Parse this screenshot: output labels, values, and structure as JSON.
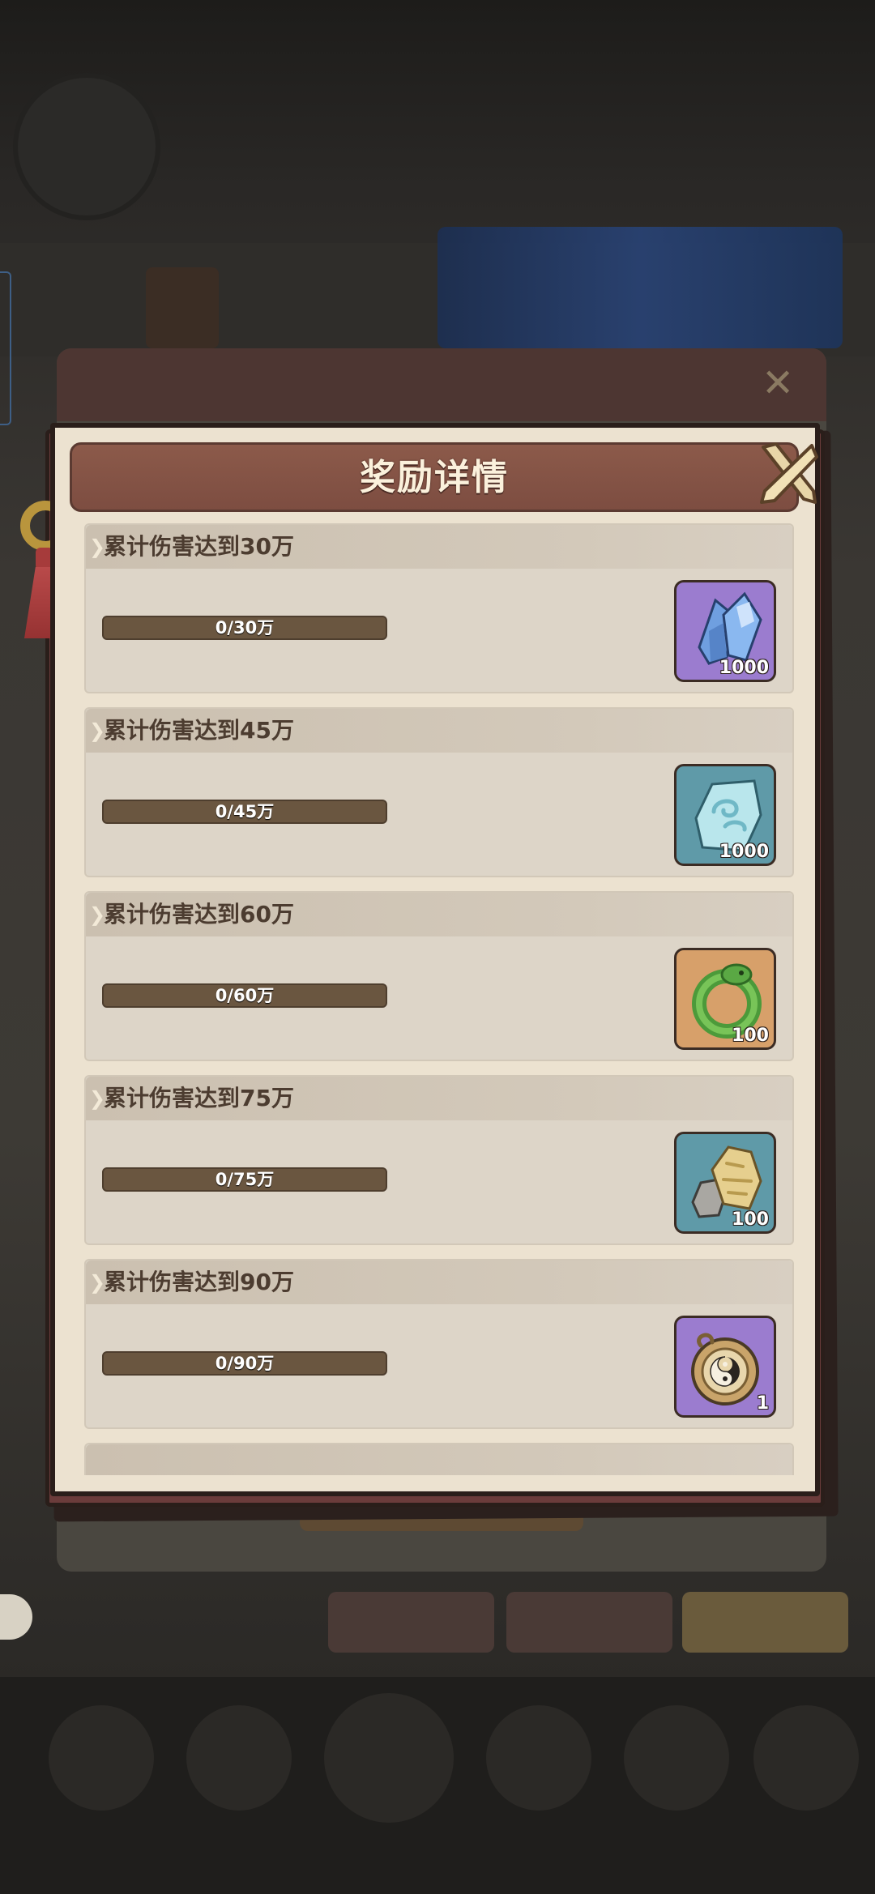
{
  "dialog": {
    "title": "奖励详情"
  },
  "rewards": [
    {
      "title": "累计伤害达到30万",
      "progress": "0/30万",
      "progress_fraction": 0,
      "item_icon": "blue-crystal-icon",
      "quantity": "1000",
      "frame_color": "#9b7ccf"
    },
    {
      "title": "累计伤害达到45万",
      "progress": "0/45万",
      "progress_fraction": 0,
      "item_icon": "cloud-jade-stone-icon",
      "quantity": "1000",
      "frame_color": "#5f9aa8"
    },
    {
      "title": "累计伤害达到60万",
      "progress": "0/60万",
      "progress_fraction": 0,
      "item_icon": "green-jade-dragon-icon",
      "quantity": "100",
      "frame_color": "#d7a06a"
    },
    {
      "title": "累计伤害达到75万",
      "progress": "0/75万",
      "progress_fraction": 0,
      "item_icon": "gold-ore-icon",
      "quantity": "100",
      "frame_color": "#5f9aa8"
    },
    {
      "title": "累计伤害达到90万",
      "progress": "0/90万",
      "progress_fraction": 0,
      "item_icon": "yin-yang-disc-icon",
      "quantity": "1",
      "frame_color": "#9b7ccf"
    }
  ]
}
